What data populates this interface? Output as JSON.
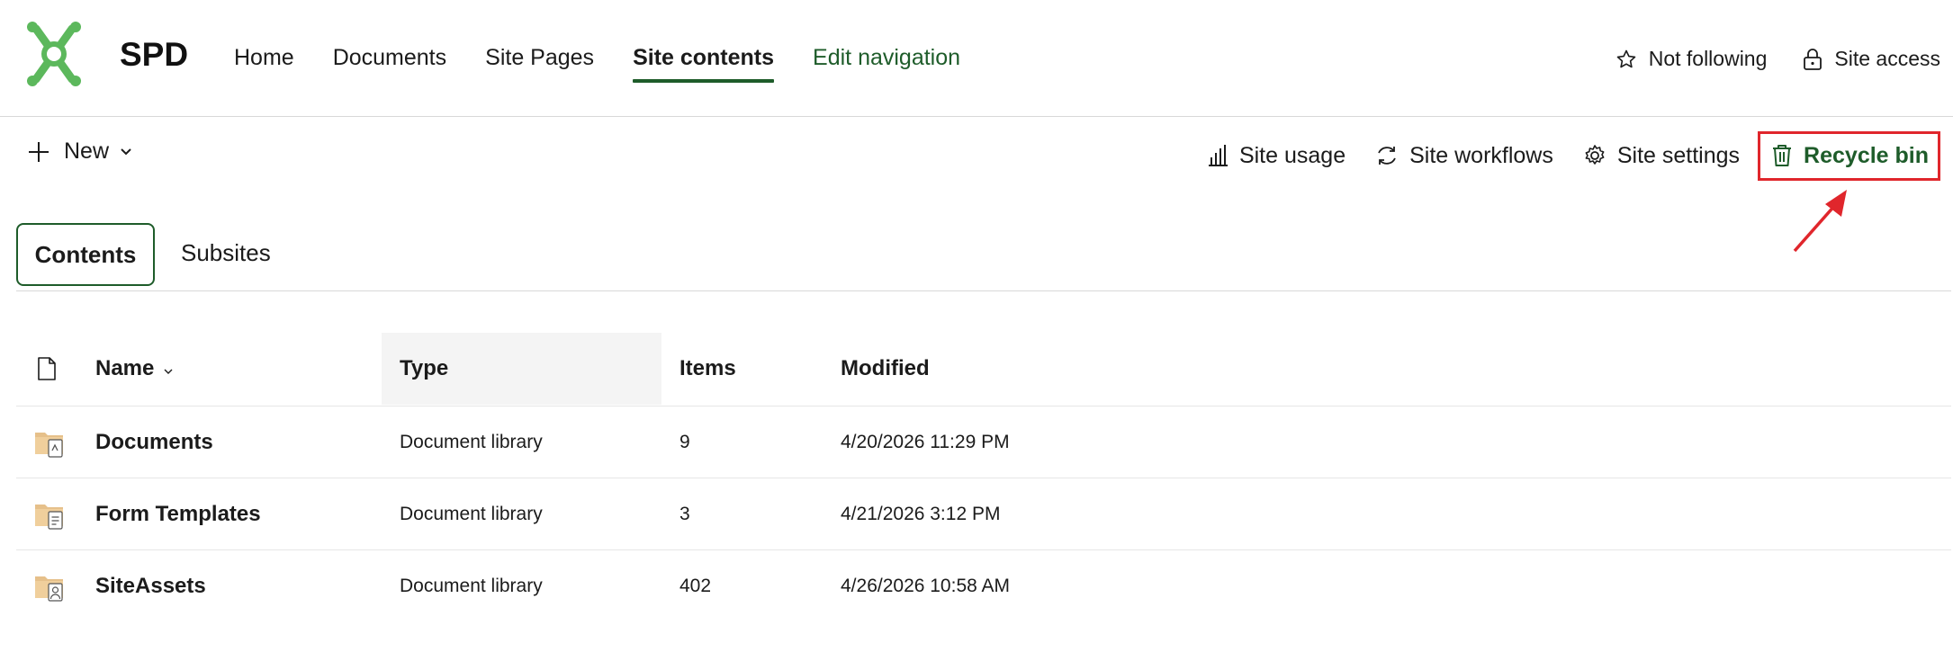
{
  "header": {
    "site_title": "SPD",
    "nav": [
      {
        "label": "Home"
      },
      {
        "label": "Documents"
      },
      {
        "label": "Site Pages"
      },
      {
        "label": "Site contents"
      },
      {
        "label": "Edit navigation"
      }
    ],
    "not_following_label": "Not following",
    "site_access_label": "Site access"
  },
  "command_bar": {
    "new_label": "New",
    "site_usage_label": "Site usage",
    "site_workflows_label": "Site workflows",
    "site_settings_label": "Site settings",
    "recycle_bin_label": "Recycle bin"
  },
  "tabs": [
    {
      "label": "Contents"
    },
    {
      "label": "Subsites"
    }
  ],
  "table": {
    "columns": {
      "name": "Name",
      "type": "Type",
      "items": "Items",
      "modified": "Modified"
    },
    "rows": [
      {
        "name": "Documents",
        "type": "Document library",
        "items": "9",
        "modified": "4/20/2026 11:29 PM",
        "icon": "library-folder-icon"
      },
      {
        "name": "Form Templates",
        "type": "Document library",
        "items": "3",
        "modified": "4/21/2026 3:12 PM",
        "icon": "library-folder-icon"
      },
      {
        "name": "SiteAssets",
        "type": "Document library",
        "items": "402",
        "modified": "4/26/2026 10:58 AM",
        "icon": "assets-folder-icon"
      }
    ]
  },
  "colors": {
    "accent": "#1e5c2a",
    "highlight_box": "#e0262c",
    "logo": "#5cb85c",
    "folder": "#e6c08a"
  }
}
